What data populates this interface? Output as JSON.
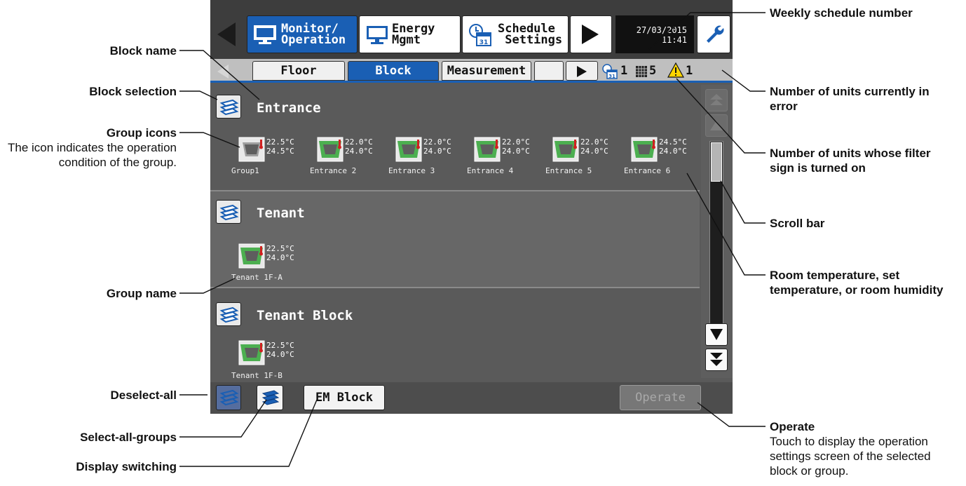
{
  "screen": {
    "nav": {
      "monitor_label": "Monitor/\nOperation",
      "energy_label": "Energy\nMgmt",
      "schedule_label": "Schedule\n Settings",
      "date": "27/03/2015",
      "time": "11:41"
    },
    "tabs": [
      {
        "label": "Floor",
        "active": false
      },
      {
        "label": "Block",
        "active": true
      },
      {
        "label": "Measurement",
        "active": false
      },
      {
        "label": "",
        "active": false
      }
    ],
    "status": {
      "weekly_schedule_number": "1",
      "filter_sign_count": "5",
      "error_count": "1"
    },
    "blocks": [
      {
        "name": "Entrance",
        "groups": [
          {
            "name": "Group1",
            "temp1": "22.5°C",
            "temp2": "24.5°C",
            "mode": "off"
          },
          {
            "name": "Entrance 2",
            "temp1": "22.0°C",
            "temp2": "24.0°C",
            "mode": "on"
          },
          {
            "name": "Entrance 3",
            "temp1": "22.0°C",
            "temp2": "24.0°C",
            "mode": "on"
          },
          {
            "name": "Entrance 4",
            "temp1": "22.0°C",
            "temp2": "24.0°C",
            "mode": "on"
          },
          {
            "name": "Entrance 5",
            "temp1": "22.0°C",
            "temp2": "24.0°C",
            "mode": "on"
          },
          {
            "name": "Entrance 6",
            "temp1": "24.5°C",
            "temp2": "24.0°C",
            "mode": "on"
          }
        ]
      },
      {
        "name": "Tenant",
        "groups": [
          {
            "name": "Tenant 1F-A",
            "temp1": "22.5°C",
            "temp2": "24.0°C",
            "mode": "on"
          }
        ]
      },
      {
        "name": "Tenant Block",
        "groups": [
          {
            "name": "Tenant 1F-B",
            "temp1": "22.5°C",
            "temp2": "24.0°C",
            "mode": "on"
          }
        ]
      }
    ],
    "bottom": {
      "em_block_label": "EM Block",
      "operate_label": "Operate"
    }
  },
  "callouts": {
    "block_name": "Block name",
    "block_selection": "Block selection",
    "group_icons": "Group icons",
    "group_icons_desc": "The icon indicates the operation condition of the group.",
    "group_name": "Group name",
    "deselect_all": "Deselect-all",
    "select_all_groups": "Select-all-groups",
    "display_switching": "Display switching",
    "weekly_schedule_number": "Weekly schedule number",
    "units_in_error": "Number of units currently in error",
    "filter_sign_units": "Number of units whose filter sign is turned on",
    "scroll_bar": "Scroll bar",
    "room_temperature": "Room temperature, set temperature, or room humidity",
    "operate": "Operate",
    "operate_desc": "Touch to display the operation settings screen of the selected block or group."
  },
  "colors": {
    "accent": "#1a5fb4",
    "screen_bg": "#5a5a5a",
    "unit_on": "#4caf50",
    "unit_off": "#9e9e9e",
    "warning": "#ffd500"
  }
}
